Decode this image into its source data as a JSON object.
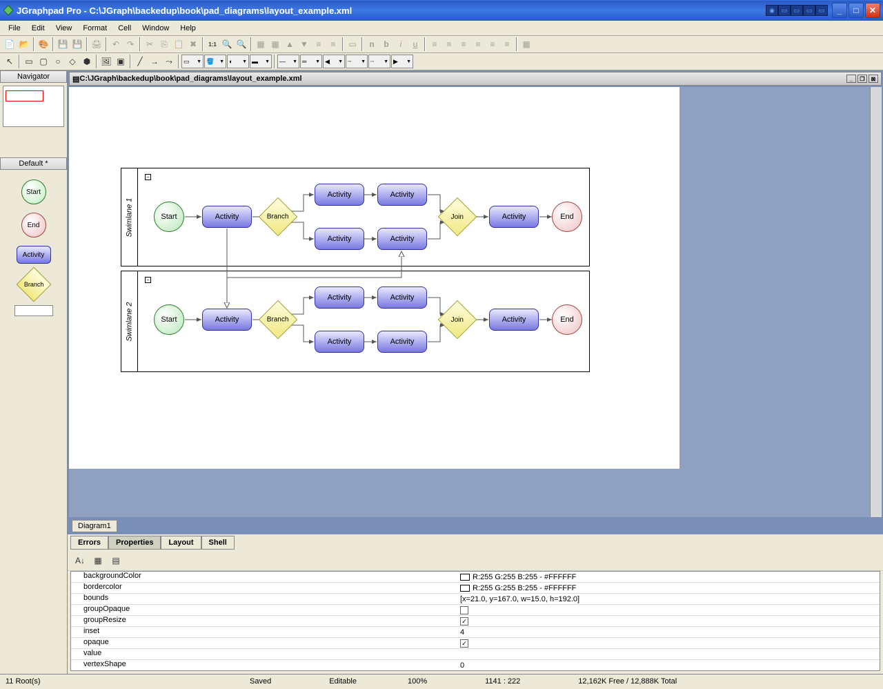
{
  "title": "JGraphpad Pro - C:\\JGraph\\backedup\\book\\pad_diagrams\\layout_example.xml",
  "menu": [
    "File",
    "Edit",
    "View",
    "Format",
    "Cell",
    "Window",
    "Help"
  ],
  "leftpanel": {
    "navigator": "Navigator",
    "palette_title": "Default *",
    "start": "Start",
    "end": "End",
    "activity": "Activity",
    "branch": "Branch"
  },
  "doc": {
    "path": "C:\\JGraph\\backedup\\book\\pad_diagrams\\layout_example.xml",
    "tab": "Diagram1"
  },
  "swimlane1": {
    "label": "Swimlane 1"
  },
  "swimlane2": {
    "label": "Swimlane 2"
  },
  "nodes": {
    "start": "Start",
    "activity": "Activity",
    "branch": "Branch",
    "join": "Join",
    "end": "End"
  },
  "bottom_tabs": [
    "Errors",
    "Properties",
    "Layout",
    "Shell"
  ],
  "props": [
    {
      "name": "backgroundColor",
      "val": "R:255 G:255 B:255 - #FFFFFF",
      "swatch": true
    },
    {
      "name": "bordercolor",
      "val": "R:255 G:255 B:255 - #FFFFFF",
      "swatch": true
    },
    {
      "name": "bounds",
      "val": "[x=21.0, y=167.0, w=15.0, h=192.0]"
    },
    {
      "name": "groupOpaque",
      "check": false
    },
    {
      "name": "groupResize",
      "check": true
    },
    {
      "name": "inset",
      "val": "4"
    },
    {
      "name": "opaque",
      "check": true
    },
    {
      "name": "value",
      "val": ""
    },
    {
      "name": "vertexShape",
      "val": "0"
    }
  ],
  "status": {
    "roots": "11 Root(s)",
    "saved": "Saved",
    "editable": "Editable",
    "zoom": "100%",
    "coords": "1141 : 222",
    "mem": "12,162K Free / 12,888K Total"
  }
}
